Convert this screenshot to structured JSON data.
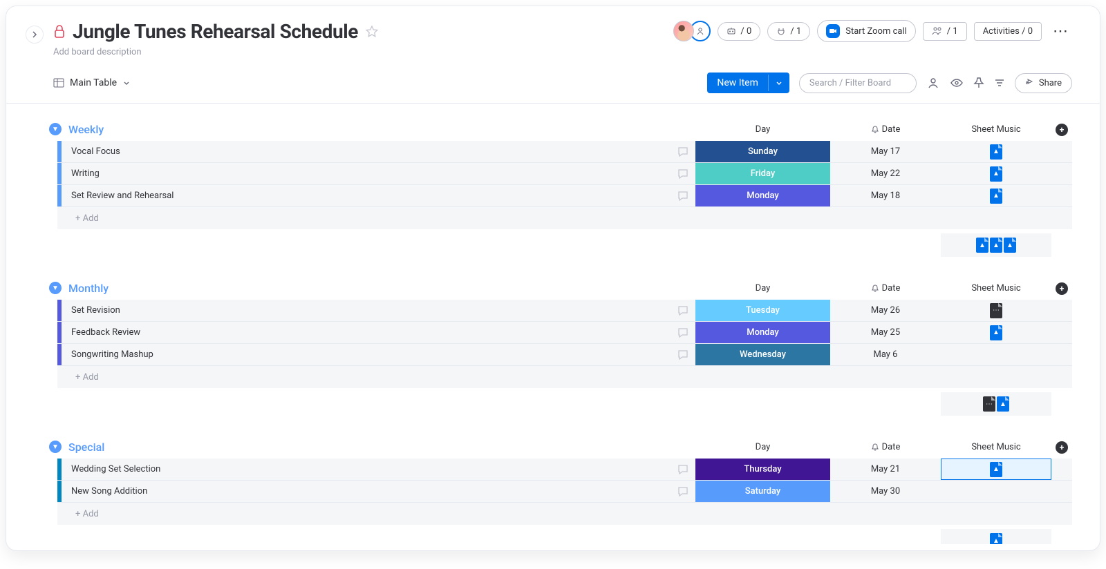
{
  "header": {
    "title": "Jungle Tunes Rehearsal Schedule",
    "description_placeholder": "Add board description",
    "automations": "/ 0",
    "integrations": "/ 1",
    "zoom_label": "Start Zoom call",
    "people": "/ 1",
    "activities": "Activities / 0"
  },
  "subheader": {
    "view_name": "Main Table",
    "new_item": "New Item",
    "search_placeholder": "Search / Filter Board",
    "share": "Share"
  },
  "columns": {
    "day": "Day",
    "date": "Date",
    "sheet": "Sheet Music"
  },
  "add_row": "+ Add",
  "groups": [
    {
      "id": "weekly",
      "title": "Weekly",
      "color": "#579bfc",
      "text_color": "#579bfc",
      "rows": [
        {
          "name": "Vocal Focus",
          "day": "Sunday",
          "day_color": "#225091",
          "date": "May 17",
          "sheet": "blue"
        },
        {
          "name": "Writing",
          "day": "Friday",
          "day_color": "#4eccc6",
          "date": "May 22",
          "sheet": "blue"
        },
        {
          "name": "Set Review and Rehearsal",
          "day": "Monday",
          "day_color": "#5559df",
          "date": "May 18",
          "sheet": "blue"
        }
      ],
      "summary": [
        "blue",
        "blue",
        "blue"
      ]
    },
    {
      "id": "monthly",
      "title": "Monthly",
      "color": "#5559df",
      "text_color": "#579bfc",
      "rows": [
        {
          "name": "Set Revision",
          "day": "Tuesday",
          "day_color": "#66ccff",
          "date": "May 26",
          "sheet": "dark"
        },
        {
          "name": "Feedback Review",
          "day": "Monday",
          "day_color": "#5559df",
          "date": "May 25",
          "sheet": "blue"
        },
        {
          "name": "Songwriting Mashup",
          "day": "Wednesday",
          "day_color": "#2b76a3",
          "date": "May 6",
          "sheet": ""
        }
      ],
      "summary": [
        "dark",
        "blue"
      ]
    },
    {
      "id": "special",
      "title": "Special",
      "color": "#0086c0",
      "text_color": "#579bfc",
      "rows": [
        {
          "name": "Wedding Set Selection",
          "day": "Thursday",
          "day_color": "#401694",
          "date": "May 21",
          "sheet": "blue",
          "sheet_hl": true
        },
        {
          "name": "New Song Addition",
          "day": "Saturday",
          "day_color": "#579bfc",
          "date": "May 30",
          "sheet": ""
        }
      ],
      "summary": [
        "blue"
      ]
    }
  ]
}
